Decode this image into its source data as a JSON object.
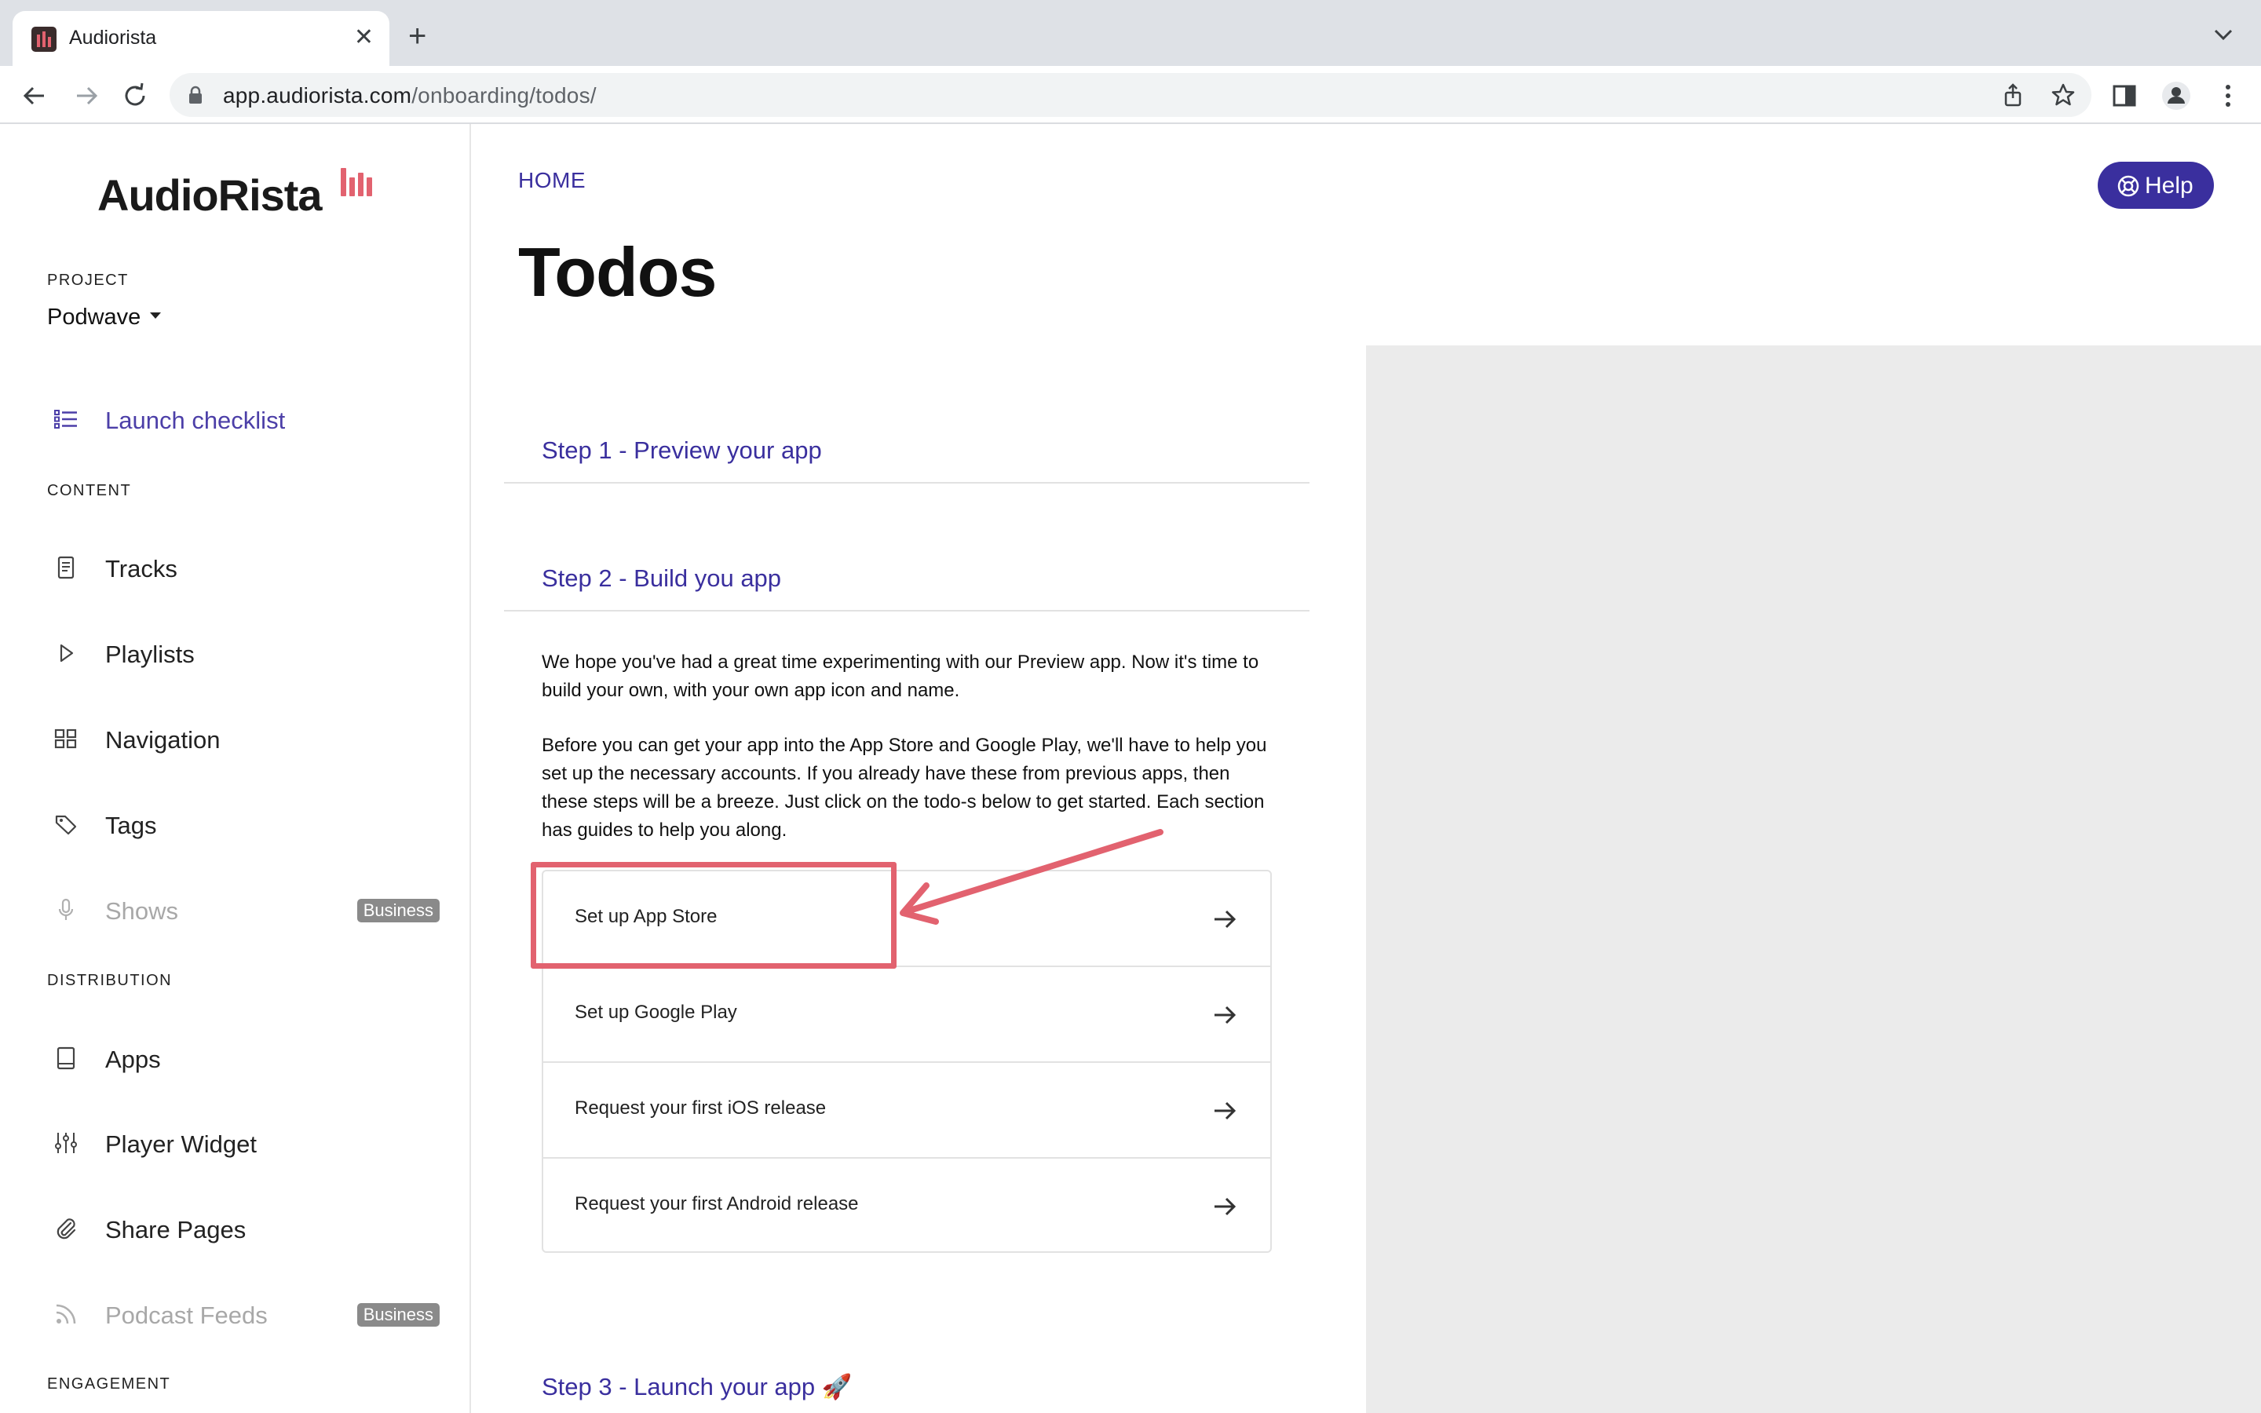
{
  "browser": {
    "tab_title": "Audiorista",
    "url_host": "app.audiorista.com",
    "url_path": "/onboarding/todos/"
  },
  "sidebar": {
    "logo": "AudioRista",
    "project_label": "PROJECT",
    "project_name": "Podwave",
    "launch_checklist": "Launch checklist",
    "content_label": "CONTENT",
    "content_items": [
      {
        "label": "Tracks",
        "icon": "document-icon"
      },
      {
        "label": "Playlists",
        "icon": "play-icon"
      },
      {
        "label": "Navigation",
        "icon": "grid-icon"
      },
      {
        "label": "Tags",
        "icon": "tag-icon"
      },
      {
        "label": "Shows",
        "icon": "microphone-icon",
        "badge": "Business"
      }
    ],
    "distribution_label": "DISTRIBUTION",
    "distribution_items": [
      {
        "label": "Apps",
        "icon": "tablet-icon"
      },
      {
        "label": "Player Widget",
        "icon": "sliders-icon"
      },
      {
        "label": "Share Pages",
        "icon": "paperclip-icon"
      },
      {
        "label": "Podcast Feeds",
        "icon": "rss-icon",
        "badge": "Business"
      }
    ],
    "engagement_label": "ENGAGEMENT"
  },
  "main": {
    "breadcrumb": "HOME",
    "title": "Todos",
    "help_label": "Help",
    "step1": "Step 1 - Preview your app",
    "step2": "Step 2 - Build you app",
    "step2_para1": "We hope you've had a great time experimenting with our Preview app. Now it's time to build your own, with your own app icon and name.",
    "step2_para2": "Before you can get your app into the App Store and Google Play, we'll have to help you set up the necessary accounts. If you already have these from previous apps, then these steps will be a breeze. Just click on the todo-s below to get started. Each section has guides to help you along.",
    "todos": [
      "Set up App Store",
      "Set up Google Play",
      "Request your first iOS release",
      "Request your first Android release"
    ],
    "step3": "Step 3 - Launch your app 🚀"
  },
  "colors": {
    "accent": "#3a2f9e",
    "brand_red": "#e2626f",
    "badge_gray": "#8a8a8a",
    "preview_gray": "#ebebeb"
  }
}
